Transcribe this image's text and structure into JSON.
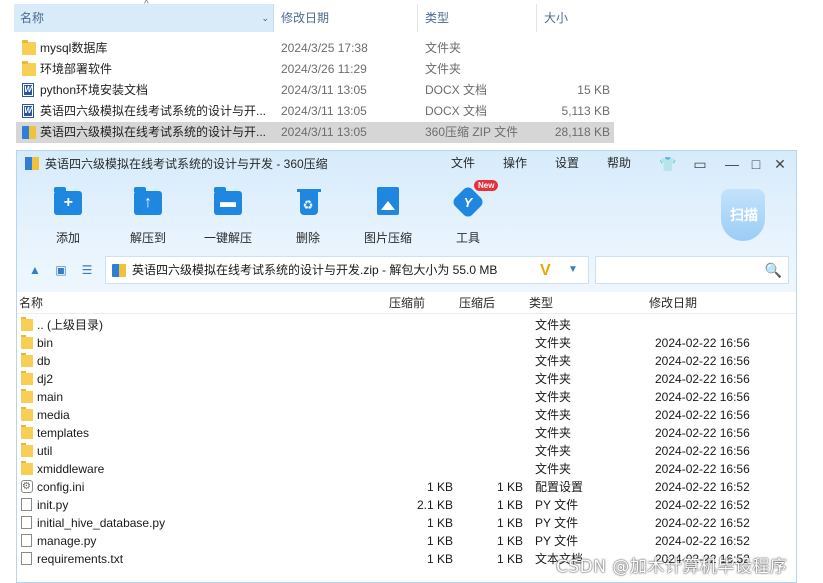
{
  "explorer": {
    "columns": {
      "name": "名称",
      "date": "修改日期",
      "type": "类型",
      "size": "大小"
    },
    "sort_arrow": "^",
    "dropdown_arrow": "⌄",
    "rows": [
      {
        "icon": "folder-icon",
        "name": "mysql数据库",
        "date": "2024/3/25 17:38",
        "type": "文件夹",
        "size": ""
      },
      {
        "icon": "folder-icon",
        "name": "环境部署软件",
        "date": "2024/3/26 11:29",
        "type": "文件夹",
        "size": ""
      },
      {
        "icon": "word-doc-icon",
        "name": "python环境安装文档",
        "date": "2024/3/11 13:05",
        "type": "DOCX 文档",
        "size": "15 KB"
      },
      {
        "icon": "word-doc-icon",
        "name": "英语四六级模拟在线考试系统的设计与开...",
        "date": "2024/3/11 13:05",
        "type": "DOCX 文档",
        "size": "5,113 KB"
      },
      {
        "icon": "zip-archive-icon",
        "name": "英语四六级模拟在线考试系统的设计与开...",
        "date": "2024/3/11 13:05",
        "type": "360压缩 ZIP 文件",
        "size": "28,118 KB",
        "selected": true
      }
    ]
  },
  "zip_window": {
    "title": "英语四六级模拟在线考试系统的设计与开发 - 360压缩",
    "menu": [
      "文件",
      "操作",
      "设置",
      "帮助"
    ],
    "titlebar_icons": [
      "skin-icon",
      "feedback-icon",
      "minimize-icon",
      "maximize-icon",
      "close-icon"
    ],
    "toolbar": [
      {
        "label": "添加",
        "icon": "add-icon"
      },
      {
        "label": "解压到",
        "icon": "extract-to-icon"
      },
      {
        "label": "一键解压",
        "icon": "one-click-extract-icon"
      },
      {
        "label": "删除",
        "icon": "delete-icon"
      },
      {
        "label": "图片压缩",
        "icon": "image-compress-icon"
      },
      {
        "label": "工具",
        "icon": "tools-icon",
        "badge": "New"
      }
    ],
    "scan_label": "扫描",
    "address": "英语四六级模拟在线考试系统的设计与开发.zip - 解包大小为 55.0 MB",
    "address_v": "V",
    "search_placeholder": "",
    "list_columns": {
      "name": "名称",
      "before": "压缩前",
      "after": "压缩后",
      "type": "类型",
      "date": "修改日期"
    },
    "items": [
      {
        "icon": "folder-icon",
        "name": ".. (上级目录)",
        "before": "",
        "after": "",
        "type": "文件夹",
        "date": ""
      },
      {
        "icon": "folder-icon",
        "name": "bin",
        "before": "",
        "after": "",
        "type": "文件夹",
        "date": "2024-02-22 16:56"
      },
      {
        "icon": "folder-icon",
        "name": "db",
        "before": "",
        "after": "",
        "type": "文件夹",
        "date": "2024-02-22 16:56"
      },
      {
        "icon": "folder-icon",
        "name": "dj2",
        "before": "",
        "after": "",
        "type": "文件夹",
        "date": "2024-02-22 16:56"
      },
      {
        "icon": "folder-icon",
        "name": "main",
        "before": "",
        "after": "",
        "type": "文件夹",
        "date": "2024-02-22 16:56"
      },
      {
        "icon": "folder-icon",
        "name": "media",
        "before": "",
        "after": "",
        "type": "文件夹",
        "date": "2024-02-22 16:56"
      },
      {
        "icon": "folder-icon",
        "name": "templates",
        "before": "",
        "after": "",
        "type": "文件夹",
        "date": "2024-02-22 16:56"
      },
      {
        "icon": "folder-icon",
        "name": "util",
        "before": "",
        "after": "",
        "type": "文件夹",
        "date": "2024-02-22 16:56"
      },
      {
        "icon": "folder-icon",
        "name": "xmiddleware",
        "before": "",
        "after": "",
        "type": "文件夹",
        "date": "2024-02-22 16:56"
      },
      {
        "icon": "config-file-icon",
        "name": "config.ini",
        "before": "1 KB",
        "after": "1 KB",
        "type": "配置设置",
        "date": "2024-02-22 16:52"
      },
      {
        "icon": "file-icon",
        "name": "init.py",
        "before": "2.1 KB",
        "after": "1 KB",
        "type": "PY 文件",
        "date": "2024-02-22 16:52"
      },
      {
        "icon": "file-icon",
        "name": "initial_hive_database.py",
        "before": "1 KB",
        "after": "1 KB",
        "type": "PY 文件",
        "date": "2024-02-22 16:52"
      },
      {
        "icon": "file-icon",
        "name": "manage.py",
        "before": "1 KB",
        "after": "1 KB",
        "type": "PY 文件",
        "date": "2024-02-22 16:52"
      },
      {
        "icon": "file-icon",
        "name": "requirements.txt",
        "before": "1 KB",
        "after": "1 KB",
        "type": "文本文档",
        "date": "2024-02-22 16:52"
      }
    ]
  },
  "watermark": "CSDN @加木计算机毕设程序"
}
